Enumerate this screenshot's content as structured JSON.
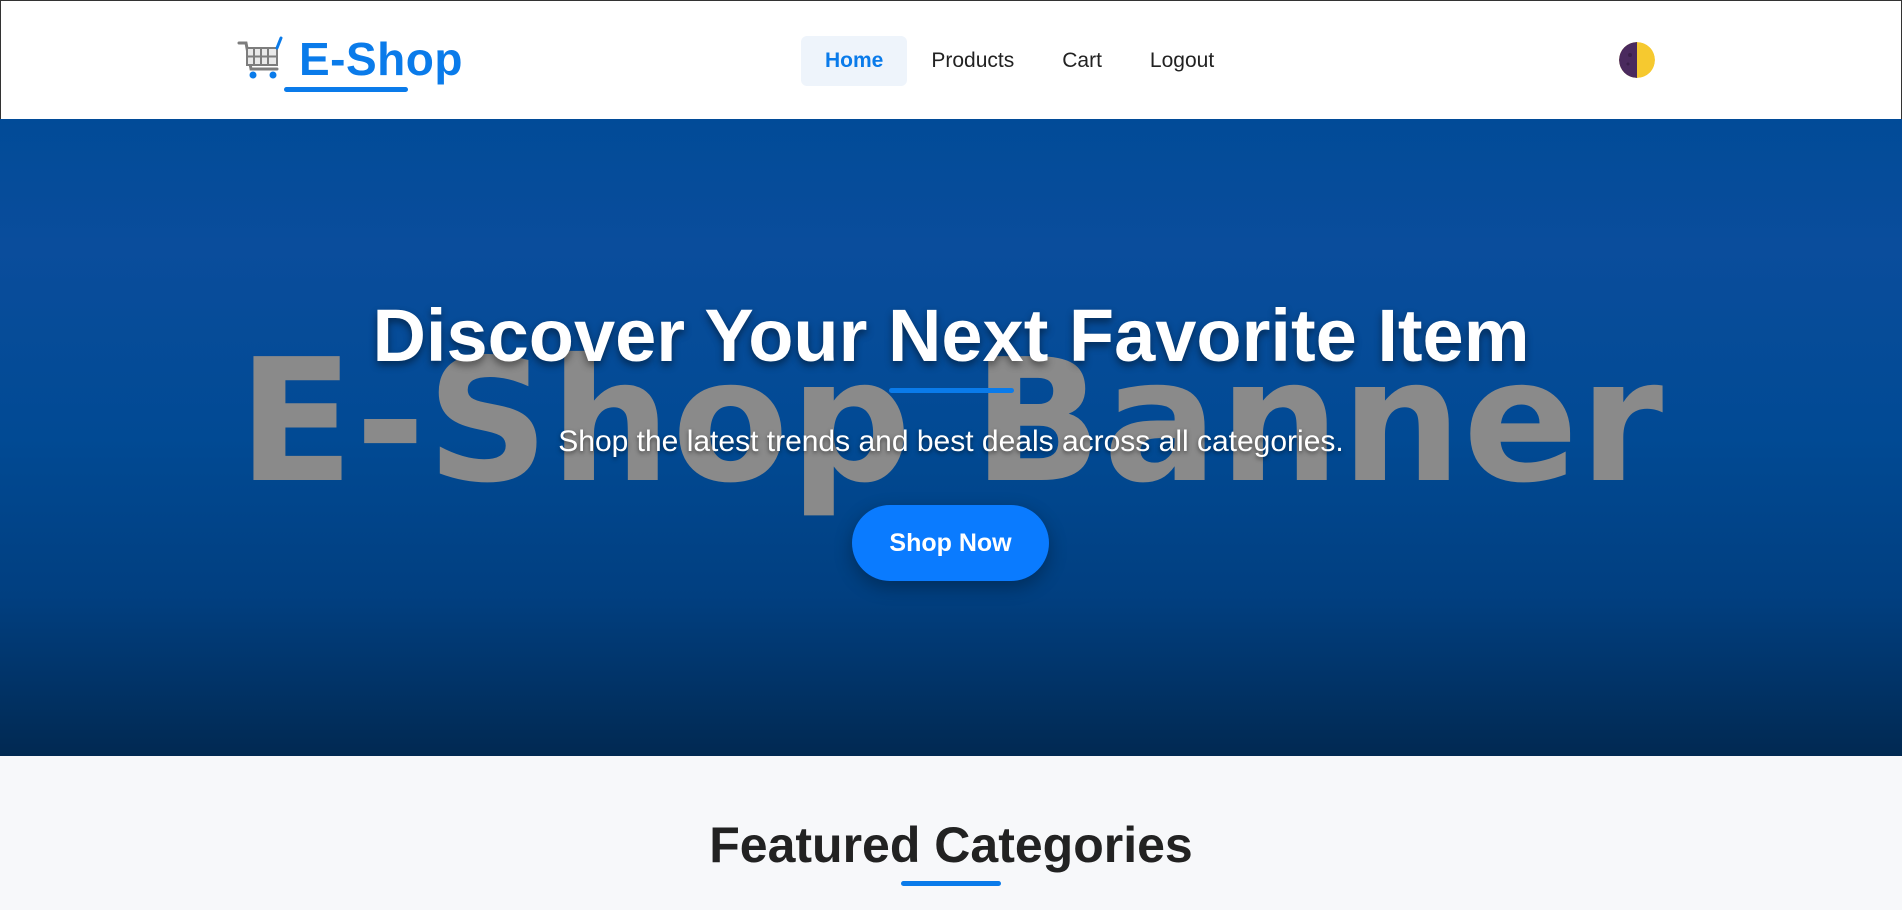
{
  "header": {
    "logo_text": "E-Shop",
    "nav": {
      "home": "Home",
      "products": "Products",
      "cart": "Cart",
      "logout": "Logout"
    },
    "active_nav": "Home"
  },
  "hero": {
    "watermark": "E-Shop Banner",
    "title": "Discover Your Next Favorite Item",
    "subtitle": "Shop the latest trends and best deals across all categories.",
    "cta_label": "Shop Now"
  },
  "featured": {
    "title": "Featured Categories"
  },
  "icons": {
    "logo": "shopping-cart-icon",
    "theme_toggle": "half-moon-theme-icon"
  },
  "colors": {
    "brand": "#0a7bea",
    "cta": "#0a7bff",
    "hero_top": "#014b98",
    "hero_bottom": "#012952",
    "page_bg": "#f7f8fa",
    "toggle_dark": "#4a2a5e",
    "toggle_light": "#f6c92f"
  }
}
